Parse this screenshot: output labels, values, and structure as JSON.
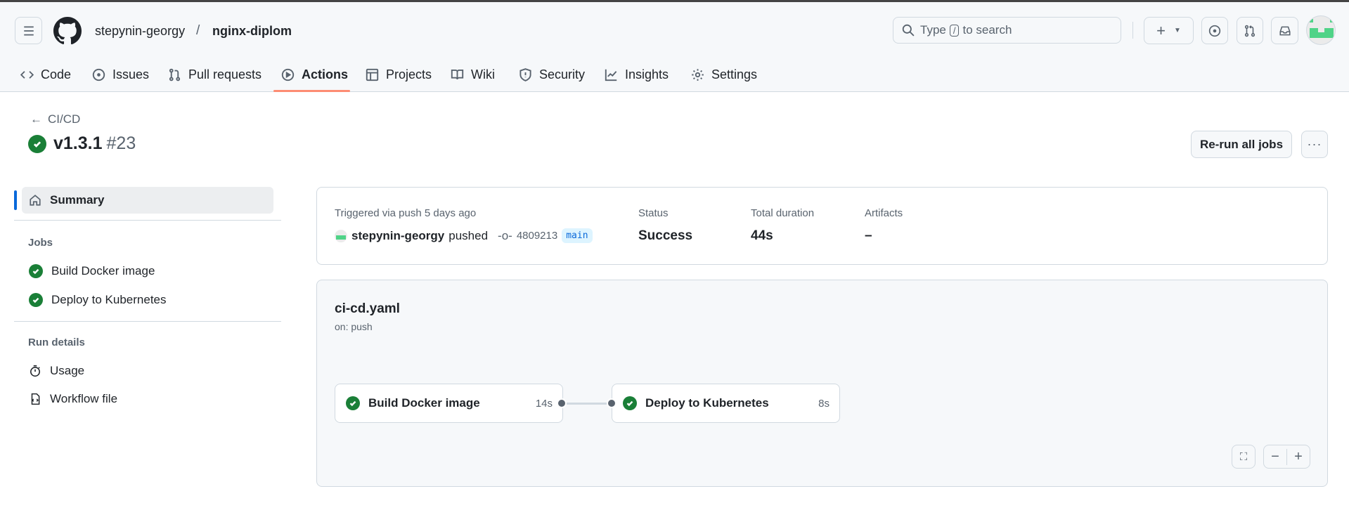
{
  "header": {
    "owner": "stepynin-georgy",
    "separator": "/",
    "repo": "nginx-diplom",
    "search": {
      "prefix": "Type",
      "key": "/",
      "suffix": "to search"
    }
  },
  "tabs": [
    {
      "label": "Code"
    },
    {
      "label": "Issues"
    },
    {
      "label": "Pull requests"
    },
    {
      "label": "Actions",
      "active": true
    },
    {
      "label": "Projects"
    },
    {
      "label": "Wiki"
    },
    {
      "label": "Security"
    },
    {
      "label": "Insights"
    },
    {
      "label": "Settings"
    }
  ],
  "run": {
    "back_label": "CI/CD",
    "title": "v1.3.1",
    "number": "#23",
    "rerun_label": "Re-run all jobs"
  },
  "sidebar": {
    "summary": "Summary",
    "jobs_heading": "Jobs",
    "jobs": [
      "Build Docker image",
      "Deploy to Kubernetes"
    ],
    "run_details_heading": "Run details",
    "usage": "Usage",
    "workflow_file": "Workflow file"
  },
  "summary": {
    "trigger": "Triggered via push 5 days ago",
    "actor": "stepynin-georgy",
    "action": "pushed",
    "commit": "4809213",
    "branch": "main",
    "status_label": "Status",
    "status": "Success",
    "duration_label": "Total duration",
    "duration": "44s",
    "artifacts_label": "Artifacts",
    "artifacts": "–"
  },
  "workflow": {
    "file": "ci-cd.yaml",
    "trigger": "on: push",
    "jobs": [
      {
        "name": "Build Docker image",
        "duration": "14s"
      },
      {
        "name": "Deploy to Kubernetes",
        "duration": "8s"
      }
    ]
  },
  "colors": {
    "success": "#1a7f37",
    "accent": "#fd8c73",
    "active_bar": "#0969da"
  }
}
